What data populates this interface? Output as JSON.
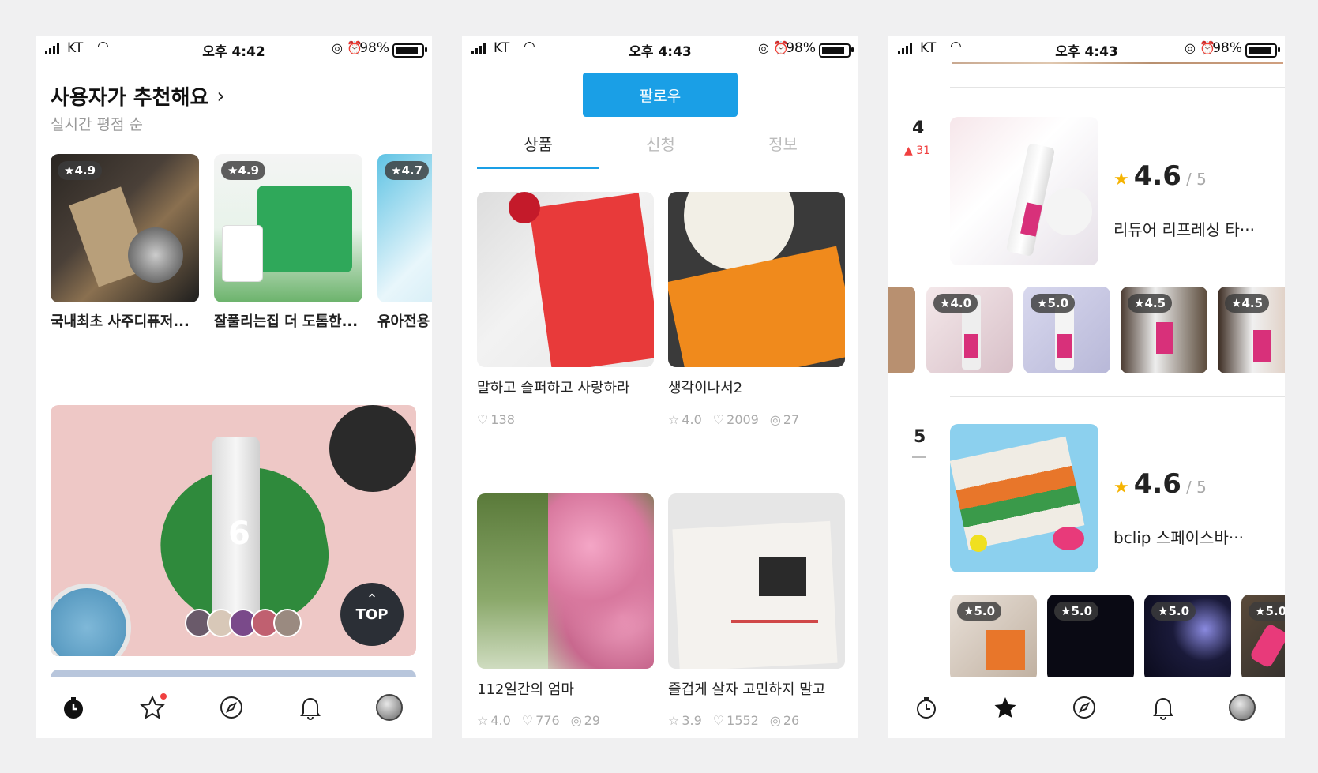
{
  "status1": {
    "carrier": "KT",
    "time": "오후 4:42",
    "battery": "98%"
  },
  "status2": {
    "carrier": "KT",
    "time": "오후 4:43",
    "battery": "98%"
  },
  "status3": {
    "carrier": "KT",
    "time": "오후 4:43",
    "battery": "98%"
  },
  "screen1": {
    "section_title": "사용자가 추천해요",
    "section_subtitle": "실시간 평점 순",
    "cards": [
      {
        "rating": "★4.9",
        "title": "국내최초 사주디퓨저..."
      },
      {
        "rating": "★4.9",
        "title": "잘풀리는집 더 도톰한..."
      },
      {
        "rating": "★4.7",
        "title": "유아전용"
      }
    ],
    "top_button": "TOP"
  },
  "screen2": {
    "follow_button": "팔로우",
    "tabs": [
      "상품",
      "신청",
      "정보"
    ],
    "products": [
      {
        "title": "말하고 슬퍼하고 사랑하라",
        "likes": "138"
      },
      {
        "title": "생각이나서2",
        "rating": "4.0",
        "likes": "2009",
        "comments": "27"
      },
      {
        "title": "112일간의 엄마",
        "rating": "4.0",
        "likes": "776",
        "comments": "29"
      },
      {
        "title": "즐겁게 살자 고민하지 말고",
        "rating": "3.9",
        "likes": "1552",
        "comments": "26"
      }
    ]
  },
  "screen3": {
    "rank4": {
      "rank": "4",
      "change": "31",
      "score": "4.6",
      "outof": "/ 5",
      "name": "리듀어 리프레싱 타···",
      "reviews": [
        "★4.0",
        "★5.0",
        "★4.5",
        "★4.5"
      ]
    },
    "rank5": {
      "rank": "5",
      "score": "4.6",
      "outof": "/ 5",
      "name": "bclip 스페이스바···",
      "reviews": [
        "★5.0",
        "★5.0",
        "★5.0",
        "★5.0"
      ]
    }
  },
  "colors": {
    "accent": "#1a9fe6",
    "star": "#f5b301",
    "up": "#f04040"
  }
}
